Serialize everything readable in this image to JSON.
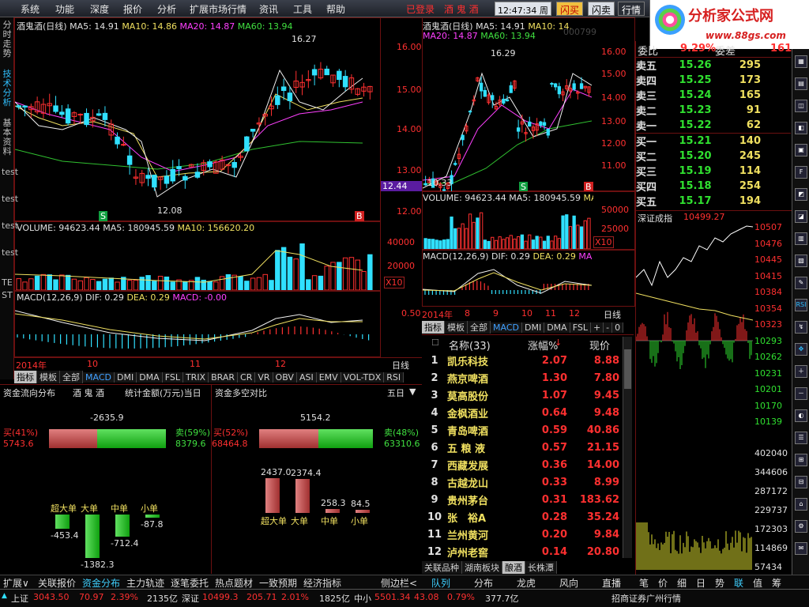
{
  "menu": {
    "items": [
      "系统",
      "功能",
      "深度",
      "报价",
      "分析",
      "扩展市场行情",
      "资讯",
      "工具",
      "帮助"
    ],
    "login_status": "已登录",
    "current_stock_title": "酒 鬼 酒",
    "clock": "12:47:34 周四",
    "btn_buy": "闪买",
    "btn_sell": "闪卖",
    "btn_quote": "行情"
  },
  "logo": {
    "name": "分析家公式网",
    "url_text": "www.88gs.com"
  },
  "left_sidebar": {
    "items": [
      "分时走势",
      "技术分析",
      "基本资料",
      "test",
      "test",
      "test",
      "test",
      "TE",
      "ST"
    ],
    "active_index": 1
  },
  "main_chart": {
    "header": {
      "name": "酒鬼酒(日线)",
      "ma5": "MA5: 14.91",
      "ma10": "MA10: 14.86",
      "ma20": "MA20: 14.87",
      "ma60": "MA60: 13.94"
    },
    "high_label": "16.27",
    "low_label": "12.08",
    "volume_header": {
      "vol": "VOLUME: 94623.44",
      "ma5": "MA5: 180945.59",
      "ma10": "MA10: 156620.20"
    },
    "macd_header": {
      "name": "MACD(12,26,9)",
      "dif": "DIF: 0.29",
      "dea": "DEA: 0.29",
      "macd": "MACD: -0.00"
    },
    "axis_price": [
      "16.00",
      "15.00",
      "14.00",
      "13.00",
      "12.00"
    ],
    "axis_vol": [
      "40000",
      "20000"
    ],
    "vol_unit": "X10",
    "axis_macd": "0.50",
    "x_labels": [
      "2014年",
      "10",
      "11",
      "12"
    ],
    "cycle": "日线",
    "s_mark": "S",
    "b_mark": "B"
  },
  "indicator_tabs": [
    "指标",
    "模板",
    "全部",
    "MACD",
    "DMI",
    "DMA",
    "FSL",
    "TRIX",
    "BRAR",
    "CR",
    "VR",
    "OBV",
    "ASI",
    "EMV",
    "VOL-TDX",
    "RSI"
  ],
  "mini_chart": {
    "header": {
      "name": "酒鬼酒(日线)",
      "ma5": "MA5: 14.91",
      "ma10": "MA10: 14.",
      "ma20": "MA20: 14.87",
      "ma60": "MA60: 13.94"
    },
    "stock_code": "000799",
    "high_label": "16.29",
    "low_label": "10.33",
    "axis_price": [
      "16.00",
      "15.00",
      "14.00",
      "13.00",
      "12.00",
      "11.00"
    ],
    "current_price": "12.44",
    "volume_header": {
      "vol": "VOLUME: 94623.44",
      "ma5": "MA5: 180945.59",
      "ma10": "MA"
    },
    "axis_vol": [
      "50000",
      "25000"
    ],
    "vol_unit": "X10",
    "macd_header": {
      "name": "MACD(12,26,9)",
      "dif": "DIF: 0.29",
      "dea": "DEA: 0.29",
      "macd": "MA"
    },
    "x_labels": [
      "2014年",
      "8",
      "9",
      "10",
      "11",
      "12"
    ],
    "cycle": "日线",
    "s_mark": "S",
    "b_mark": "B"
  },
  "mini_tabs": [
    "指标",
    "模板",
    "全部",
    "MACD",
    "DMI",
    "DMA",
    "FSL"
  ],
  "mini_tab_controls": [
    "+",
    "-",
    "0"
  ],
  "order_book": {
    "weibi_label": "委比",
    "weibi": "9.29%",
    "weicha_label": "委差",
    "weicha": "161",
    "asks": [
      {
        "label": "卖五",
        "price": "15.26",
        "vol": "295"
      },
      {
        "label": "卖四",
        "price": "15.25",
        "vol": "173"
      },
      {
        "label": "卖三",
        "price": "15.24",
        "vol": "165"
      },
      {
        "label": "卖二",
        "price": "15.23",
        "vol": "91"
      },
      {
        "label": "卖一",
        "price": "15.22",
        "vol": "62"
      }
    ],
    "bids": [
      {
        "label": "买一",
        "price": "15.21",
        "vol": "140"
      },
      {
        "label": "买二",
        "price": "15.20",
        "vol": "245"
      },
      {
        "label": "买三",
        "price": "15.19",
        "vol": "114"
      },
      {
        "label": "买四",
        "price": "15.18",
        "vol": "254"
      },
      {
        "label": "买五",
        "price": "15.17",
        "vol": "194"
      }
    ]
  },
  "index_chart": {
    "name": "深证成指",
    "value": "10499.27",
    "axis": [
      "10507",
      "10476",
      "10445",
      "10415",
      "10384",
      "10354",
      "10323",
      "10293",
      "10262",
      "10231",
      "10201",
      "10170",
      "10139"
    ],
    "vol_axis": [
      "402040",
      "344606",
      "287172",
      "229737",
      "172303",
      "114869",
      "57434"
    ]
  },
  "stock_list": {
    "header": {
      "name": "名称(33)",
      "change": "涨幅%",
      "price": "现价"
    },
    "rows": [
      {
        "no": "1",
        "name": "凯乐科技",
        "change": "2.07",
        "price": "8.88"
      },
      {
        "no": "2",
        "name": "燕京啤酒",
        "change": "1.30",
        "price": "7.80"
      },
      {
        "no": "3",
        "name": "莫高股份",
        "change": "1.07",
        "price": "9.45"
      },
      {
        "no": "4",
        "name": "金枫酒业",
        "change": "0.64",
        "price": "9.48"
      },
      {
        "no": "5",
        "name": "青岛啤酒",
        "change": "0.59",
        "price": "40.86"
      },
      {
        "no": "6",
        "name": "五 粮 液",
        "change": "0.57",
        "price": "21.15"
      },
      {
        "no": "7",
        "name": "西藏发展",
        "change": "0.36",
        "price": "14.00"
      },
      {
        "no": "8",
        "name": "古越龙山",
        "change": "0.33",
        "price": "8.99"
      },
      {
        "no": "9",
        "name": "贵州茅台",
        "change": "0.31",
        "price": "183.62"
      },
      {
        "no": "10",
        "name": "张　裕A",
        "change": "0.28",
        "price": "35.24"
      },
      {
        "no": "11",
        "name": "兰州黄河",
        "change": "0.20",
        "price": "9.84"
      },
      {
        "no": "12",
        "name": "泸州老窖",
        "change": "0.14",
        "price": "20.80"
      }
    ],
    "tabs": [
      "关联品种",
      "湖南板块",
      "酿酒",
      "长株潭"
    ]
  },
  "fund_flow": {
    "title": "资金流向分布",
    "stock": "酒 鬼 酒",
    "unit": "统计金额(万元)当日",
    "net": "-2635.9",
    "buy_label": "买(41%)",
    "buy_value": "5743.6",
    "buy_pct": 41,
    "sell_label": "卖(59%)",
    "sell_value": "8379.6",
    "bars": [
      {
        "label": "超大单",
        "value": "-453.4"
      },
      {
        "label": "大单",
        "value": "-1382.3"
      },
      {
        "label": "中单",
        "value": "-712.4"
      },
      {
        "label": "小单",
        "value": "-87.8"
      }
    ]
  },
  "long_short": {
    "title": "资金多空对比",
    "period": "五日",
    "net": "5154.2",
    "buy_label": "买(52%)",
    "buy_value": "68464.8",
    "buy_pct": 52,
    "sell_label": "卖(48%)",
    "sell_value": "63310.6",
    "bars": [
      {
        "label": "超大单",
        "value": "2437.0"
      },
      {
        "label": "大单",
        "value": "2374.4"
      },
      {
        "label": "中单",
        "value": "258.3"
      },
      {
        "label": "小单",
        "value": "84.5"
      }
    ]
  },
  "bottom_tabs": [
    "扩展∨",
    "关联报价",
    "资金分布",
    "主力轨迹",
    "逐笔委托",
    "热点题材",
    "一致预期",
    "经济指标",
    "侧边栏<"
  ],
  "right_tabs": [
    "笔",
    "价",
    "细",
    "日",
    "势",
    "联",
    "值",
    "筹"
  ],
  "list_bottom_tabs": [
    "队列",
    "分布",
    "龙虎",
    "风向",
    "直播"
  ],
  "status": {
    "sh_label": "上证",
    "sh_value": "3043.50",
    "sh_change": "70.97",
    "sh_pct": "2.39%",
    "sh_amount": "2135亿",
    "sz_label": "深证",
    "sz_value": "10499.3",
    "sz_change": "205.71",
    "sz_pct": "2.01%",
    "sz_amount": "1825亿",
    "zx_label": "中小",
    "zx_value": "5501.34",
    "zx_change": "43.08",
    "zx_pct": "0.79%",
    "zx_amount": "377.7亿",
    "broker": "招商证券广州行情"
  },
  "colors": {
    "up": "#ff3030",
    "down": "#30e0ff",
    "ma5": "#f0f0f0",
    "ma10": "#f0e060",
    "ma20": "#ff40ff",
    "ma60": "#30c030"
  }
}
